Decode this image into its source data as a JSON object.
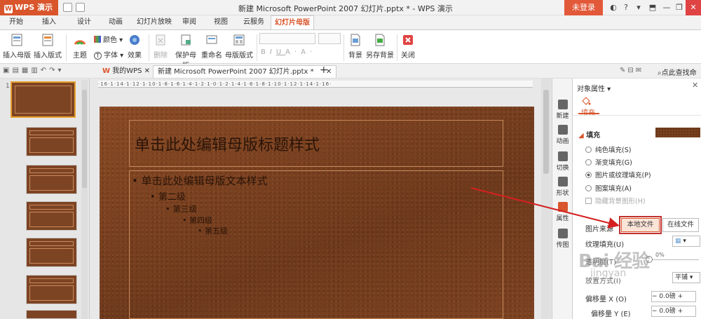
{
  "app": {
    "name": "WPS 演示",
    "doc_title": "新建 Microsoft PowerPoint 2007 幻灯片.pptx * - WPS 演示",
    "login": "未登录"
  },
  "ribbon_tabs": [
    "开始",
    "插入",
    "设计",
    "动画",
    "幻灯片放映",
    "审阅",
    "视图",
    "云服务",
    "幻灯片母版"
  ],
  "ribbon": {
    "insert_master": "插入母版",
    "insert_layout": "插入版式",
    "theme": "主题",
    "color": "颜色",
    "font": "字体",
    "effect": "效果",
    "delete": "删除",
    "protect_master": "保护母版",
    "rename": "重命名",
    "master_layout": "母版版式",
    "background": "背景",
    "save_background": "另存背景",
    "close": "关闭"
  },
  "doc_tabs": {
    "my_wps": "我的WPS",
    "doc": "新建 Microsoft PowerPoint 2007 幻灯片.pptx *",
    "search": "点此查找命"
  },
  "thumbnails": {
    "selected_num": "1"
  },
  "ruler_text": "·16·1·14·1·12·1·10·1·8·1·6·1·4·1·2·1·0·1·2·1·4·1·6·1·8·1·10·1·12·1·14·1·16·",
  "slide": {
    "title": "单击此处编辑母版标题样式",
    "bullets": [
      "单击此处编辑母版文本样式",
      "第二级",
      "第三级",
      "第四级",
      "第五级"
    ]
  },
  "side_tabs": [
    "新建",
    "动画",
    "切换",
    "形状",
    "属性",
    "传图"
  ],
  "panel": {
    "title": "对象属性",
    "tab_fill": "填充",
    "fill_header": "填充",
    "options": [
      "纯色填充(S)",
      "渐变填充(G)",
      "图片或纹理填充(P)",
      "图案填充(A)"
    ],
    "hide_bg": "隐藏背景图形(H)",
    "picture_source": "图片来源",
    "local_file": "本地文件",
    "online_file": "在线文件",
    "texture_fill": "纹理填充(U)",
    "transparency": "透明度(T)",
    "transparency_value": "0%",
    "tile_label": "放置方式(I)",
    "tile_value": "平铺",
    "offset_x": "偏移量 X (O)",
    "offset_x_value": "0.0磅",
    "offset_y": "偏移量 Y (E)",
    "offset_y_value": "0.0磅"
  },
  "watermark": {
    "main": "Bai 经验",
    "sub": "jingyan"
  },
  "colors": {
    "accent": "#d9552b",
    "slide_bg": "#7d4220",
    "highlight_box": "#c0322e"
  }
}
